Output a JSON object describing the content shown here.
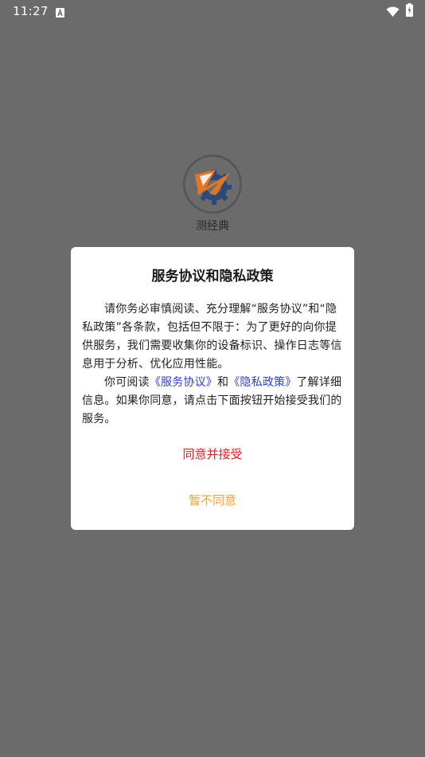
{
  "status_bar": {
    "time": "11:27",
    "notification_icon": "a-icon",
    "wifi_icon": "wifi-icon",
    "battery_icon": "battery-charging-icon"
  },
  "app": {
    "logo_icon": "app-logo-icon",
    "name": "测经典"
  },
  "dialog": {
    "title": "服务协议和隐私政策",
    "paragraph1": "请你务必审慎阅读、充分理解“服务协议”和“隐私政策”各条款，包括但不限于：为了更好的向你提供服务，我们需要收集你的设备标识、操作日志等信息用于分析、优化应用性能。",
    "p2_prefix": "你可阅读",
    "service_agreement_link": "《服务协议》",
    "p2_and": "和",
    "privacy_policy_link": "《隐私政策》",
    "p2_suffix": "了解详细信息。如果你同意，请点击下面按钮开始接受我们的服务。",
    "agree_label": "同意并接受",
    "disagree_label": "暂不同意"
  },
  "colors": {
    "overlay": "#6b6b6b",
    "link": "#2b3fd6",
    "agree": "#e51c23",
    "disagree": "#f5a31a"
  }
}
